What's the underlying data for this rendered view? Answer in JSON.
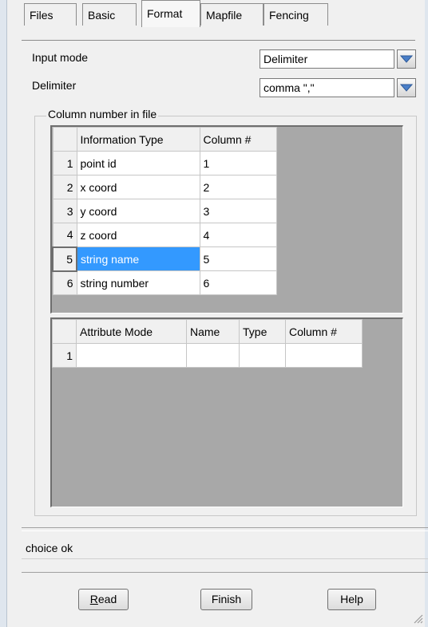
{
  "tabs": [
    {
      "label": "Files"
    },
    {
      "label": "Basic"
    },
    {
      "label": "Format"
    },
    {
      "label": "Mapfile"
    },
    {
      "label": "Fencing"
    }
  ],
  "active_tab": "Format",
  "input_mode": {
    "label": "Input mode",
    "value": "Delimiter"
  },
  "delimiter": {
    "label": "Delimiter",
    "value": "comma \",\""
  },
  "column_group": {
    "title": "Column number in file"
  },
  "info_table": {
    "headers": [
      "Information Type",
      "Column #"
    ],
    "rows": [
      {
        "num": "1",
        "type": "point id",
        "col": "1"
      },
      {
        "num": "2",
        "type": "x coord",
        "col": "2"
      },
      {
        "num": "3",
        "type": "y coord",
        "col": "3"
      },
      {
        "num": "4",
        "type": "z coord",
        "col": "4"
      },
      {
        "num": "5",
        "type": "string name",
        "col": "5"
      },
      {
        "num": "6",
        "type": "string number",
        "col": "6"
      }
    ],
    "selected_row": "5"
  },
  "attr_table": {
    "headers": [
      "Attribute Mode",
      "Name",
      "Type",
      "Column #"
    ],
    "rows": [
      {
        "num": "1",
        "mode": "",
        "name": "",
        "type": "",
        "col": ""
      }
    ]
  },
  "status": "choice ok",
  "buttons": {
    "read_prefix": "",
    "read_ul": "R",
    "read_rest": "ead",
    "finish": "Finish",
    "help": "Help"
  },
  "colors": {
    "selection": "#3399ff",
    "grid_bg": "#a8a8a8",
    "combo_arrow": "#4a7fc8"
  }
}
